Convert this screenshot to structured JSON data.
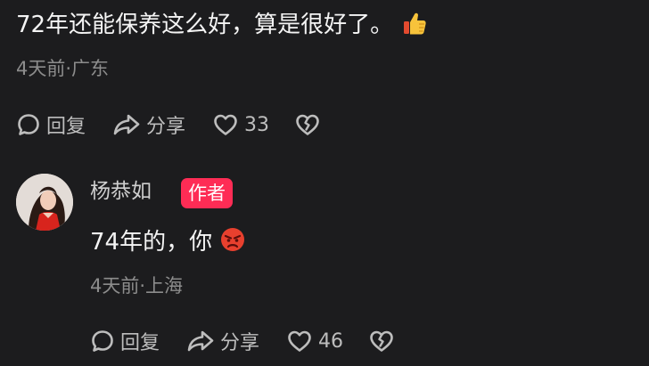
{
  "colors": {
    "background": "#1c1c1e",
    "text": "#f4f4f4",
    "meta": "#8c8c8c",
    "action": "#bdbdbd",
    "author_badge": "#fe2c55"
  },
  "comment1": {
    "text": "72年还能保养这么好，算是很好了。",
    "emoji": "thumbs-up-icon",
    "meta": "4天前·广东",
    "reply_label": "回复",
    "share_label": "分享",
    "like_count": "33"
  },
  "comment2": {
    "author": "杨恭如",
    "badge": "作者",
    "text": "74年的，你",
    "emoji": "angry-face-icon",
    "meta": "4天前·上海",
    "reply_label": "回复",
    "share_label": "分享",
    "like_count": "46"
  }
}
